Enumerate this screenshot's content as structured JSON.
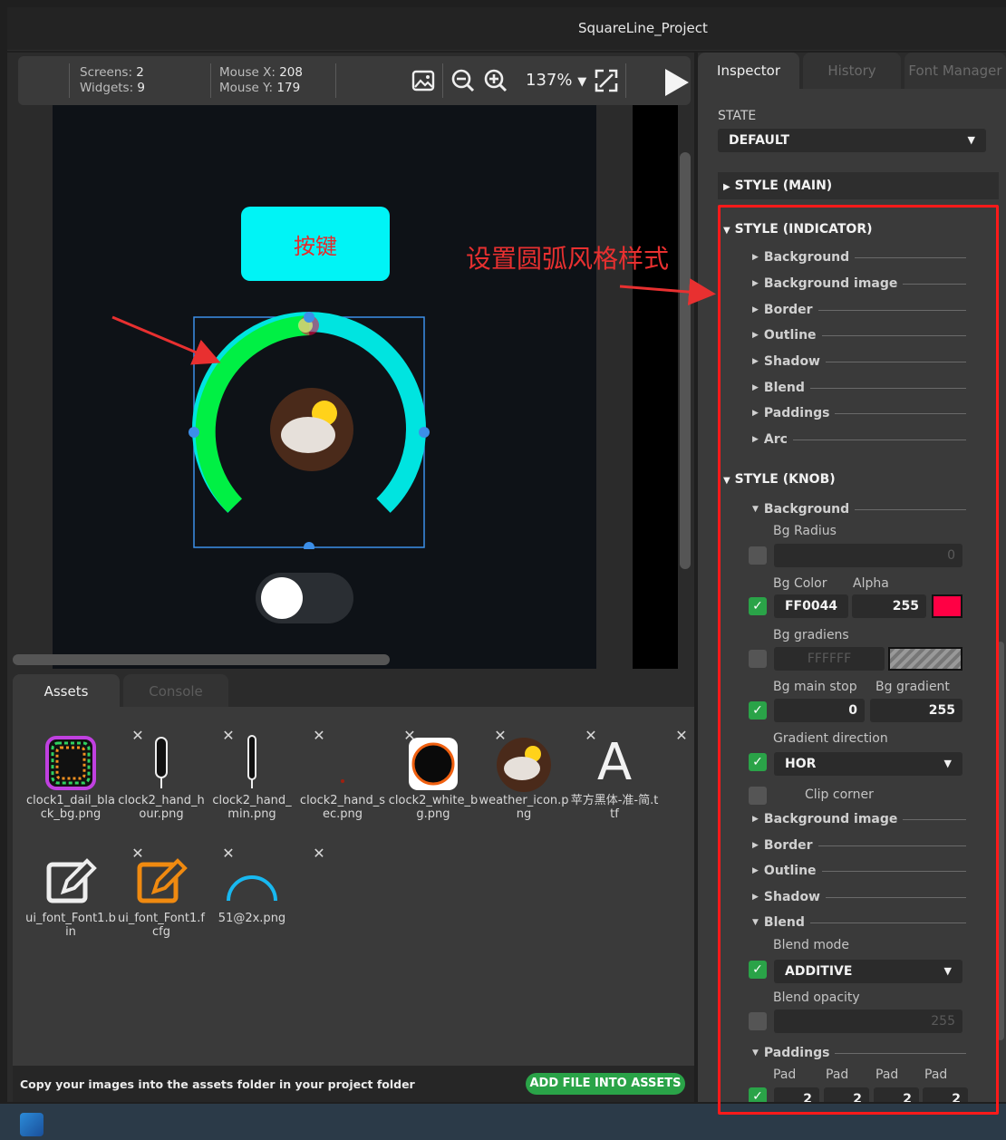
{
  "window": {
    "title": "SquareLine_Project"
  },
  "toolbar": {
    "screens_label": "Screens:",
    "screens_value": "2",
    "widgets_label": "Widgets:",
    "widgets_value": "9",
    "mouse_x_label": "Mouse X:",
    "mouse_x_value": "208",
    "mouse_y_label": "Mouse Y:",
    "mouse_y_value": "179",
    "zoom": "137%",
    "icons": [
      "image-icon",
      "zoom-out-icon",
      "zoom-in-icon",
      "caret-down-icon",
      "fit-screen-icon",
      "play-icon"
    ]
  },
  "canvas": {
    "button_text": "按键",
    "annotation": "设置圆弧风格样式",
    "arc_colors": {
      "start": "#00ff40",
      "end": "#00e4e0",
      "knob": "#ff0044"
    },
    "switch_on": false
  },
  "bottom_tabs": {
    "assets": "Assets",
    "console": "Console"
  },
  "assets": [
    {
      "name": "clock1_dail_black_bg.png"
    },
    {
      "name": "clock2_hand_hour.png"
    },
    {
      "name": "clock2_hand_min.png"
    },
    {
      "name": "clock2_hand_sec.png"
    },
    {
      "name": "clock2_white_bg.png"
    },
    {
      "name": "weather_icon.png"
    },
    {
      "name": "苹方黑体-准-简.ttf"
    },
    {
      "name": "ui_font_Font1.bin"
    },
    {
      "name": "ui_font_Font1.fcfg"
    },
    {
      "name": "51@2x.png"
    }
  ],
  "footer": {
    "message": "Copy your images into the assets folder in your project folder",
    "add_button": "ADD FILE INTO ASSETS"
  },
  "inspector": {
    "tabs": [
      "Inspector",
      "History",
      "Font Manager"
    ],
    "state_label": "STATE",
    "state_value": "DEFAULT",
    "style_main": "STYLE (MAIN)",
    "style_indicator": "STYLE (INDICATOR)",
    "indicator_items": [
      "Background",
      "Background image",
      "Border",
      "Outline",
      "Shadow",
      "Blend",
      "Paddings",
      "Arc"
    ],
    "style_knob": "STYLE (KNOB)",
    "knob_background": "Background",
    "bg_radius_label": "Bg Radius",
    "bg_radius_value": "0",
    "bg_color_label": "Bg Color",
    "alpha_label": "Alpha",
    "bg_color_value": "FF0044",
    "alpha_value": "255",
    "swatch_color": "#ff0044",
    "bg_gradiens_label": "Bg gradiens",
    "bg_gradiens_value": "FFFFFF",
    "bg_main_stop_label": "Bg main stop",
    "bg_gradient_label": "Bg gradient",
    "bg_main_stop_value": "0",
    "bg_gradient_value": "255",
    "gradient_direction_label": "Gradient direction",
    "gradient_direction_value": "HOR",
    "clip_corner_label": "Clip corner",
    "knob_items": [
      "Background image",
      "Border",
      "Outline",
      "Shadow"
    ],
    "blend_label": "Blend",
    "blend_mode_label": "Blend mode",
    "blend_mode_value": "ADDITIVE",
    "blend_opacity_label": "Blend opacity",
    "blend_opacity_value": "255",
    "paddings_label": "Paddings",
    "pad_labels": [
      "Pad",
      "Pad",
      "Pad",
      "Pad"
    ],
    "pad_values": [
      "2",
      "2",
      "2",
      "2"
    ]
  },
  "accent_color": "#2aa348",
  "highlight_color": "#ff1a1a"
}
